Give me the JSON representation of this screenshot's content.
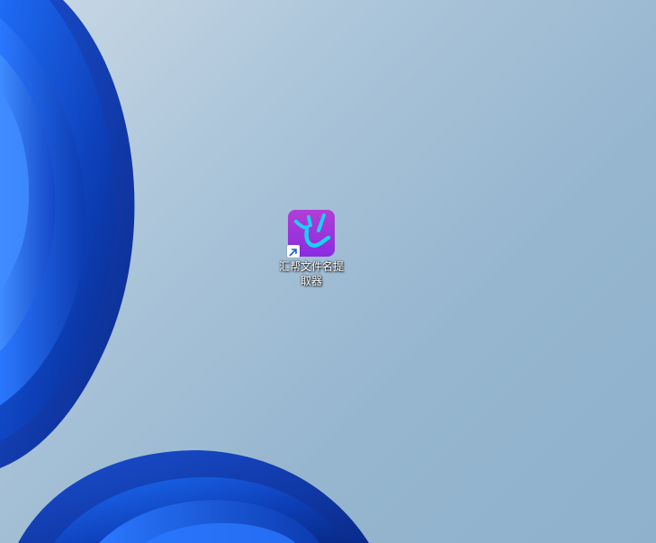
{
  "desktop": {
    "background_colors": {
      "top_left": "#c9d9e6",
      "bottom_right": "#8fb1cc",
      "bloom_dark": "#0a2a8c",
      "bloom_mid": "#1f58d6",
      "bloom_light": "#3f8cff"
    },
    "icons": [
      {
        "name": "app-shortcut",
        "label": "汇帮文件名提取器",
        "icon_gradient_top": "#b13fd4",
        "icon_gradient_bottom": "#8a2be2",
        "glyph_color": "#19d2f0",
        "is_shortcut": true
      }
    ]
  }
}
